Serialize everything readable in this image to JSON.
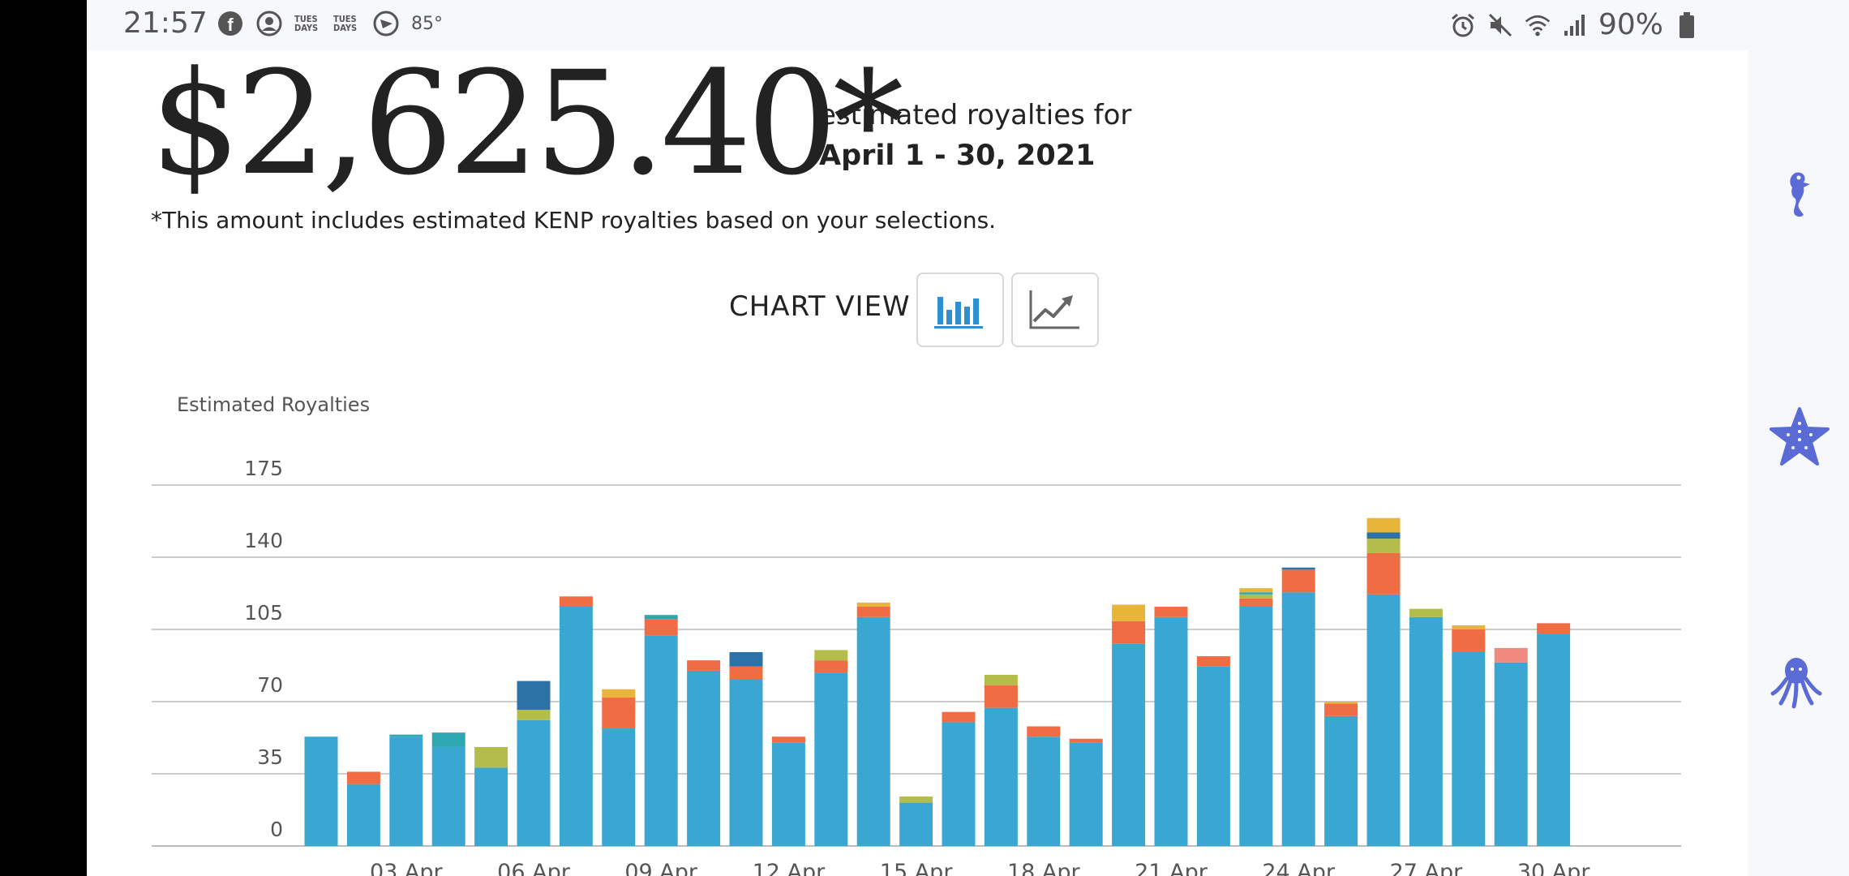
{
  "status_bar": {
    "time": "21:57",
    "temperature": "85°",
    "tues_label_1": "TUES DAYS",
    "tues_label_2": "TUES DAYS",
    "battery": "90%",
    "icons": [
      "facebook-icon",
      "account-icon",
      "tuesdays-icon",
      "tuesdays-icon",
      "play-icon",
      "alarm-icon",
      "mute-icon",
      "wifi-icon",
      "signal-icon",
      "battery-icon"
    ]
  },
  "summary": {
    "amount": "$2,625.40*",
    "label": "estimated royalties for",
    "date_range": "April 1 - 30, 2021",
    "note": "*This amount includes estimated KENP royalties based on your selections."
  },
  "chart_view": {
    "label": "CHART VIEW",
    "options": [
      "bar-chart-icon",
      "line-chart-icon"
    ],
    "selected": "bar"
  },
  "right_rail_icons": [
    "seahorse-icon",
    "starfish-icon",
    "octopus-icon"
  ],
  "colors": {
    "series_1": "#3aa7d2",
    "series_2": "#ef6c45",
    "series_3": "#b5bd4a",
    "series_4": "#2c72a6",
    "series_5": "#2fa7b0",
    "series_6": "#e8b43a",
    "series_7": "#f08a80",
    "grid": "#cccccc",
    "rail_icon": "#5b6bd6"
  },
  "chart_data": {
    "type": "bar",
    "stacked": true,
    "ylabel": "Estimated Royalties",
    "ylim": [
      0,
      175
    ],
    "yticks": [
      0,
      35,
      70,
      105,
      140,
      175
    ],
    "grid": true,
    "x_tick_labels": [
      "03 Apr",
      "06 Apr",
      "09 Apr",
      "12 Apr",
      "15 Apr",
      "18 Apr",
      "21 Apr",
      "24 Apr",
      "27 Apr",
      "30 Apr"
    ],
    "categories": [
      "01 Apr",
      "02 Apr",
      "03 Apr",
      "04 Apr",
      "05 Apr",
      "06 Apr",
      "07 Apr",
      "08 Apr",
      "09 Apr",
      "10 Apr",
      "11 Apr",
      "12 Apr",
      "13 Apr",
      "14 Apr",
      "15 Apr",
      "16 Apr",
      "17 Apr",
      "18 Apr",
      "19 Apr",
      "20 Apr",
      "21 Apr",
      "22 Apr",
      "23 Apr",
      "24 Apr",
      "25 Apr",
      "26 Apr",
      "27 Apr",
      "28 Apr",
      "29 Apr",
      "30 Apr"
    ],
    "series": [
      {
        "color": "#3aa7d2",
        "values": [
          53,
          30,
          53,
          48,
          38,
          61,
          116,
          57,
          102,
          85,
          81,
          50,
          84,
          111,
          21,
          60,
          67,
          53,
          50,
          98,
          111,
          87,
          116,
          123,
          63,
          122,
          111,
          94,
          89,
          103
        ]
      },
      {
        "color": "#ef6c45",
        "values": [
          0,
          6,
          0,
          0,
          0,
          0,
          5,
          15,
          8,
          5,
          6,
          3,
          6,
          5,
          0,
          5,
          11,
          5,
          2,
          11,
          5,
          5,
          4,
          11,
          6,
          20,
          0,
          11,
          0,
          5
        ]
      },
      {
        "color": "#b5bd4a",
        "values": [
          0,
          0,
          0,
          0,
          10,
          5,
          0,
          0,
          0,
          0,
          0,
          0,
          5,
          0,
          3,
          0,
          5,
          0,
          0,
          0,
          0,
          0,
          2,
          0,
          0,
          7,
          4,
          0,
          0,
          0
        ]
      },
      {
        "color": "#2c72a6",
        "values": [
          0,
          0,
          0,
          0,
          0,
          14,
          0,
          0,
          0,
          0,
          7,
          0,
          0,
          0,
          0,
          0,
          0,
          0,
          0,
          0,
          0,
          0,
          0,
          1,
          0,
          3,
          0,
          0,
          0,
          0
        ]
      },
      {
        "color": "#2fa7b0",
        "values": [
          0,
          0,
          1,
          7,
          0,
          0,
          0,
          0,
          2,
          0,
          0,
          0,
          0,
          0,
          0,
          0,
          0,
          0,
          0,
          0,
          0,
          0,
          1,
          0,
          0,
          0,
          0,
          0,
          0,
          0
        ]
      },
      {
        "color": "#e8b43a",
        "values": [
          0,
          0,
          0,
          0,
          0,
          0,
          0,
          4,
          0,
          0,
          0,
          0,
          0,
          2,
          0,
          0,
          0,
          0,
          0,
          8,
          0,
          0,
          2,
          0,
          1,
          7,
          0,
          2,
          0,
          0
        ]
      },
      {
        "color": "#f08a80",
        "values": [
          0,
          0,
          0,
          0,
          0,
          0,
          0,
          0,
          0,
          0,
          0,
          0,
          0,
          0,
          0,
          0,
          0,
          0,
          0,
          0,
          0,
          0,
          0,
          0,
          0,
          0,
          0,
          0,
          7,
          0
        ]
      }
    ]
  }
}
